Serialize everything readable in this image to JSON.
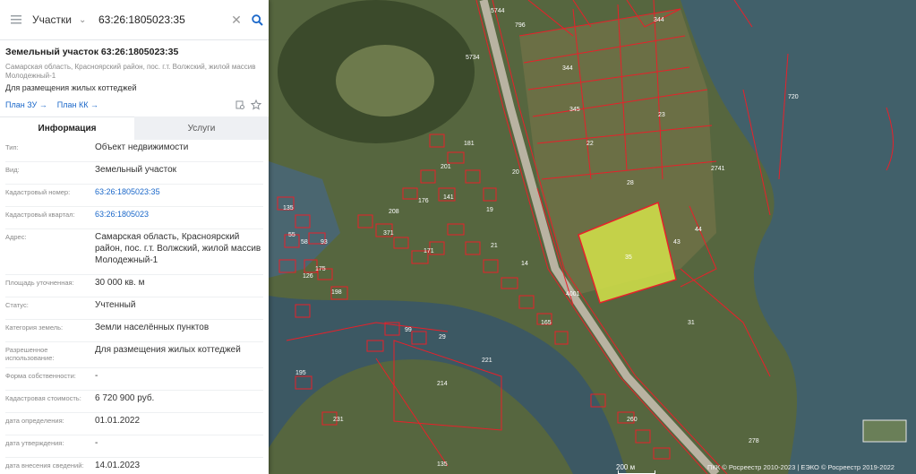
{
  "search": {
    "layer": "Участки",
    "query": "63:26:1805023:35"
  },
  "card": {
    "title": "Земельный участок 63:26:1805023:35",
    "address": "Самарская область, Красноярский район, пос. г.т. Волжский, жилой массив Молодежный-1",
    "purpose": "Для размещения жилых коттеджей",
    "links": [
      "План ЗУ →",
      "План КК →"
    ]
  },
  "tabs": [
    "Информация",
    "Услуги"
  ],
  "info": [
    {
      "key": "Тип:",
      "value": "Объект недвижимости"
    },
    {
      "key": "Вид:",
      "value": "Земельный участок"
    },
    {
      "key": "Кадастровый номер:",
      "value": "63:26:1805023:35"
    },
    {
      "key": "Кадастровый квартал:",
      "value": "63:26:1805023"
    },
    {
      "key": "Адрес:",
      "value": "Самарская область, Красноярский район, пос. г.т. Волжский, жилой массив Молодежный-1"
    },
    {
      "key": "Площадь уточненная:",
      "value": "30 000 кв. м"
    },
    {
      "key": "Статус:",
      "value": "Учтенный"
    },
    {
      "key": "Категория земель:",
      "value": "Земли населённых пунктов"
    },
    {
      "key": "Разрешенное использование:",
      "value": "Для размещения жилых коттеджей"
    },
    {
      "key": "Форма собственности:",
      "value": "-"
    },
    {
      "key": "Кадастровая стоимость:",
      "value": "6 720 900 руб."
    },
    {
      "key": "дата определения:",
      "value": "01.01.2022"
    },
    {
      "key": "дата утверждения:",
      "value": "-"
    },
    {
      "key": "дата внесения сведений:",
      "value": "14.01.2023"
    }
  ],
  "map": {
    "labels": [
      "344",
      "796",
      "344",
      "23",
      "22",
      "28",
      "43",
      "44",
      "35",
      "31",
      "345",
      "20",
      "19",
      "21",
      "14",
      "99",
      "29",
      "221",
      "214",
      "195",
      "231",
      "135",
      "55",
      "58",
      "93",
      "135",
      "126",
      "198",
      "175",
      "141",
      "165",
      "208",
      "201",
      "181",
      "260",
      "371",
      "278",
      "176",
      "171",
      "720",
      "5744",
      "2741",
      "5734",
      "4001"
    ],
    "scale": "200 м",
    "copyright": "ПКК © Росреестр 2010-2023 | ЕЭКО © Росреестр 2019-2022"
  },
  "colors": {
    "selected_parcel": "#d4e34a",
    "parcel_border": "#e8202a",
    "link": "#1a67c9",
    "water": "#3f5a66"
  }
}
